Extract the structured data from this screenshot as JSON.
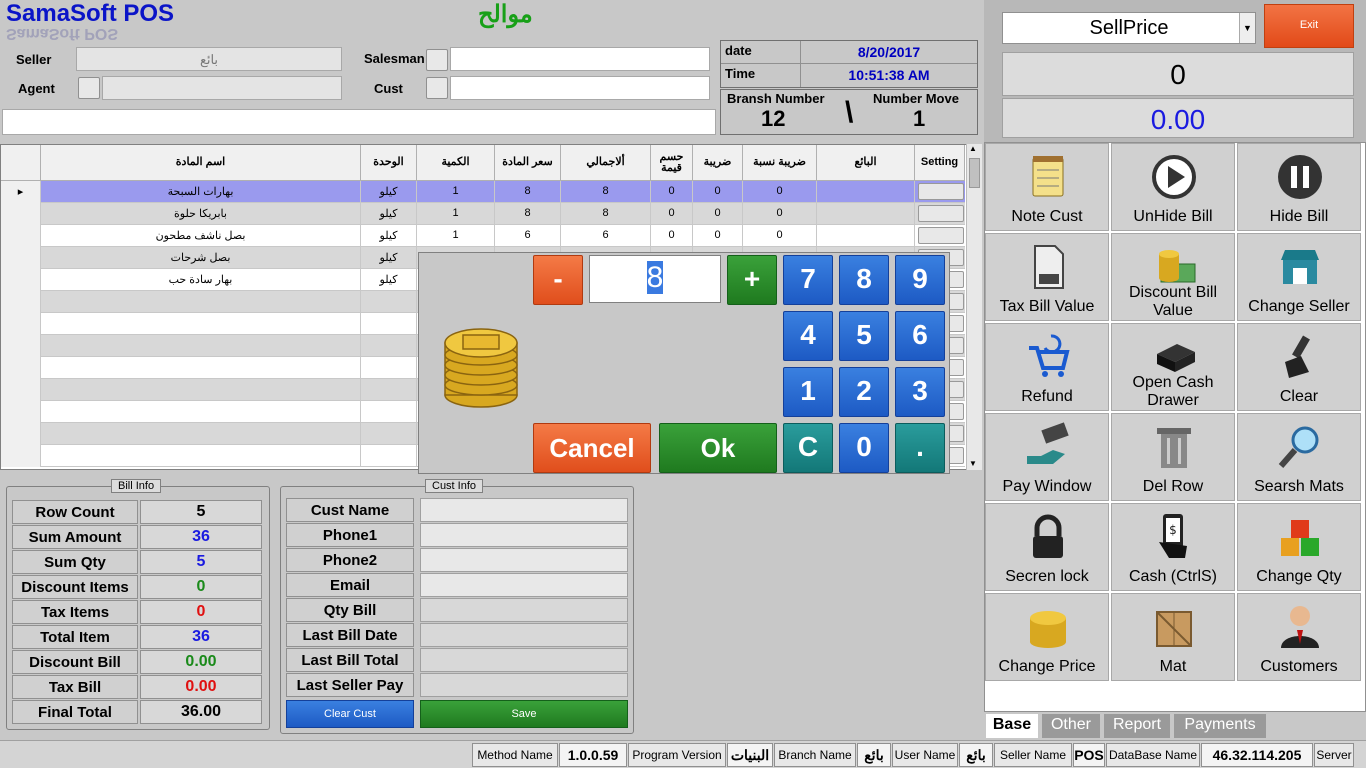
{
  "header": {
    "app_title": "SamaSoft POS",
    "shop_name": "موالح",
    "seller_label": "Seller",
    "seller_value": "بائع",
    "agent_label": "Agent",
    "salesman_label": "Salesman",
    "cust_label": "Cust",
    "date_label": "date",
    "date_value": "8/20/2017",
    "time_label": "Time",
    "time_value": "10:51:38 AM",
    "branch_label": "Bransh Number",
    "branch_value": "12",
    "sep": "\\",
    "move_label": "Number Move",
    "move_value": "1"
  },
  "top_right": {
    "price_mode": "SellPrice",
    "exit_label": "Exit",
    "qty_display": "0",
    "amount_display": "0.00"
  },
  "grid": {
    "columns": [
      "اسم المادة",
      "الوحدة",
      "الكمية",
      "سعر المادة",
      "ألاجمالي",
      "حسم قيمة",
      "ضريبة",
      "ضريبة نسبة",
      "البائع",
      "Setting"
    ],
    "rows": [
      {
        "name": "بهارات السبحة",
        "unit": "كيلو",
        "qty": "1",
        "price": "8",
        "total": "8",
        "disc": "0",
        "tax": "0",
        "taxp": "0"
      },
      {
        "name": "بابريكا حلوة",
        "unit": "كيلو",
        "qty": "1",
        "price": "8",
        "total": "8",
        "disc": "0",
        "tax": "0",
        "taxp": "0"
      },
      {
        "name": "بصل ناشف مطحون",
        "unit": "كيلو",
        "qty": "1",
        "price": "6",
        "total": "6",
        "disc": "0",
        "tax": "0",
        "taxp": "0"
      },
      {
        "name": "بصل شرحات",
        "unit": "كيلو",
        "qty": "",
        "price": "",
        "total": "",
        "disc": "",
        "tax": "",
        "taxp": ""
      },
      {
        "name": "بهار سادة حب",
        "unit": "كيلو",
        "qty": "",
        "price": "",
        "total": "",
        "disc": "",
        "tax": "",
        "taxp": ""
      }
    ]
  },
  "numpad": {
    "minus": "-",
    "plus": "+",
    "value": "8",
    "keys": [
      "7",
      "8",
      "9",
      "4",
      "5",
      "6",
      "1",
      "2",
      "3",
      "C",
      "0",
      "."
    ],
    "cancel": "Cancel",
    "ok": "Ok"
  },
  "bill_info": {
    "title": "Bill Info",
    "rows": [
      {
        "label": "Row Count",
        "value": "5",
        "color": "#000000"
      },
      {
        "label": "Sum Amount",
        "value": "36",
        "color": "#1a1ae0"
      },
      {
        "label": "Sum Qty",
        "value": "5",
        "color": "#1a1ae0"
      },
      {
        "label": "Discount Items",
        "value": "0",
        "color": "#1a8a1a"
      },
      {
        "label": "Tax Items",
        "value": "0",
        "color": "#e01010"
      },
      {
        "label": "Total Item",
        "value": "36",
        "color": "#1a1ae0"
      },
      {
        "label": "Discount Bill",
        "value": "0.00",
        "color": "#1a8a1a"
      },
      {
        "label": "Tax Bill",
        "value": "0.00",
        "color": "#e01010"
      },
      {
        "label": "Final Total",
        "value": "36.00",
        "color": "#000000"
      }
    ]
  },
  "cust_info": {
    "title": "Cust Info",
    "labels": [
      "Cust Name",
      "Phone1",
      "Phone2",
      "Email",
      "Qty Bill",
      "Last Bill Date",
      "Last Bill Total",
      "Last Seller Pay"
    ],
    "clear": "Clear Cust",
    "save": "Save"
  },
  "tiles": [
    {
      "label": "Note Cust",
      "icon": "notes-icon"
    },
    {
      "label": "UnHide Bill",
      "icon": "play-icon"
    },
    {
      "label": "Hide Bill",
      "icon": "pause-icon"
    },
    {
      "label": "Tax Bill Value",
      "icon": "tax-file-icon"
    },
    {
      "label": "Discount Bill Value",
      "icon": "coins-cash-icon"
    },
    {
      "label": "Change Seller",
      "icon": "shop-icon"
    },
    {
      "label": "Refund",
      "icon": "cart-refund-icon"
    },
    {
      "label": "Open Cash Drawer",
      "icon": "cash-drawer-icon"
    },
    {
      "label": "Clear",
      "icon": "brush-icon"
    },
    {
      "label": "Pay Window",
      "icon": "payment-hand-icon"
    },
    {
      "label": "Del Row",
      "icon": "trash-icon"
    },
    {
      "label": "Searsh Mats",
      "icon": "magnifier-icon"
    },
    {
      "label": "Secren lock",
      "icon": "lock-icon"
    },
    {
      "label": "Cash (CtrlS)",
      "icon": "phone-cash-icon"
    },
    {
      "label": "Change Qty",
      "icon": "boxes-icon"
    },
    {
      "label": "Change Price",
      "icon": "coin-stack-icon"
    },
    {
      "label": "Mat",
      "icon": "crate-icon"
    },
    {
      "label": "Customers",
      "icon": "customer-icon"
    }
  ],
  "tabs": [
    "Base",
    "Other",
    "Report",
    "Payments"
  ],
  "status": [
    {
      "text": "Method Name",
      "bold": false
    },
    {
      "text": "1.0.0.59",
      "bold": true
    },
    {
      "text": "Program Version",
      "bold": false
    },
    {
      "text": "البنيات",
      "bold": true
    },
    {
      "text": "Branch Name",
      "bold": false
    },
    {
      "text": "بائع",
      "bold": true
    },
    {
      "text": "User Name",
      "bold": false
    },
    {
      "text": "بائع",
      "bold": true
    },
    {
      "text": "Seller Name",
      "bold": false
    },
    {
      "text": "POS",
      "bold": true
    },
    {
      "text": "DataBase Name",
      "bold": false
    },
    {
      "text": "46.32.114.205",
      "bold": true
    },
    {
      "text": "Server",
      "bold": false
    }
  ]
}
